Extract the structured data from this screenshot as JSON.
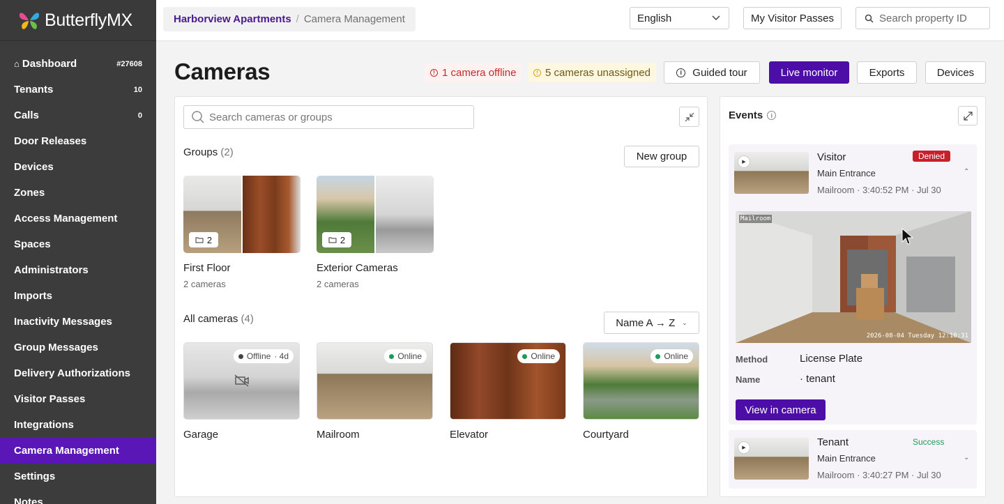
{
  "brand": {
    "name": "ButterflyMX"
  },
  "sidebar": {
    "items": [
      {
        "label": "Dashboard",
        "badge": "#27608"
      },
      {
        "label": "Tenants",
        "badge": "10"
      },
      {
        "label": "Calls",
        "badge": "0"
      },
      {
        "label": "Door Releases",
        "badge": ""
      },
      {
        "label": "Devices",
        "badge": ""
      },
      {
        "label": "Zones",
        "badge": ""
      },
      {
        "label": "Access Management",
        "badge": ""
      },
      {
        "label": "Spaces",
        "badge": ""
      },
      {
        "label": "Administrators",
        "badge": ""
      },
      {
        "label": "Imports",
        "badge": ""
      },
      {
        "label": "Inactivity Messages",
        "badge": ""
      },
      {
        "label": "Group Messages",
        "badge": ""
      },
      {
        "label": "Delivery Authorizations",
        "badge": ""
      },
      {
        "label": "Visitor Passes",
        "badge": ""
      },
      {
        "label": "Integrations",
        "badge": ""
      },
      {
        "label": "Camera Management",
        "badge": ""
      },
      {
        "label": "Settings",
        "badge": ""
      },
      {
        "label": "Notes",
        "badge": ""
      }
    ],
    "active_index": 15
  },
  "topbar": {
    "breadcrumb": {
      "property": "Harborview Apartments",
      "separator": "/",
      "current": "Camera Management"
    },
    "language": "English",
    "visitor_passes": "My Visitor Passes",
    "search_placeholder": "Search property ID"
  },
  "header": {
    "title": "Cameras",
    "alert_offline": "1 camera offline",
    "alert_unassigned": "5 cameras unassigned",
    "guided_tour": "Guided tour",
    "live_monitor": "Live monitor",
    "exports": "Exports",
    "devices": "Devices"
  },
  "main": {
    "search_placeholder": "Search cameras or groups",
    "groups_label": "Groups",
    "groups_count": "(2)",
    "new_group": "New group",
    "groups": [
      {
        "name": "First Floor",
        "sub": "2 cameras",
        "count": "2"
      },
      {
        "name": "Exterior Cameras",
        "sub": "2 cameras",
        "count": "2"
      }
    ],
    "all_label": "All cameras",
    "all_count": "(4)",
    "sort": "Name A → Z",
    "cameras": [
      {
        "name": "Garage",
        "status": "Offline",
        "age": "· 4d"
      },
      {
        "name": "Mailroom",
        "status": "Online"
      },
      {
        "name": "Elevator",
        "status": "Online"
      },
      {
        "name": "Courtyard",
        "status": "Online"
      }
    ]
  },
  "events": {
    "title": "Events",
    "items": [
      {
        "type": "Visitor",
        "status": "Denied",
        "location": "Main Entrance",
        "meta": "Mailroom · 3:40:52 PM · Jul 30"
      },
      {
        "type": "Tenant",
        "status": "Success",
        "location": "Main Entrance",
        "meta": "Mailroom · 3:40:27 PM · Jul 30"
      }
    ],
    "live_osd_top": "Mailroom",
    "live_osd_bottom": "2026-08-04 Tuesday 12:10:31",
    "method_label": "Method",
    "method_value": "License Plate",
    "name_label": "Name",
    "name_value": "· tenant",
    "view_in_camera": "View in camera"
  },
  "colors": {
    "accent": "#4d0ea8",
    "sidebar_bg": "#3c3c3c",
    "active_nav": "#5b16b8",
    "danger": "#c81f2a",
    "online": "#1e9a5b"
  }
}
